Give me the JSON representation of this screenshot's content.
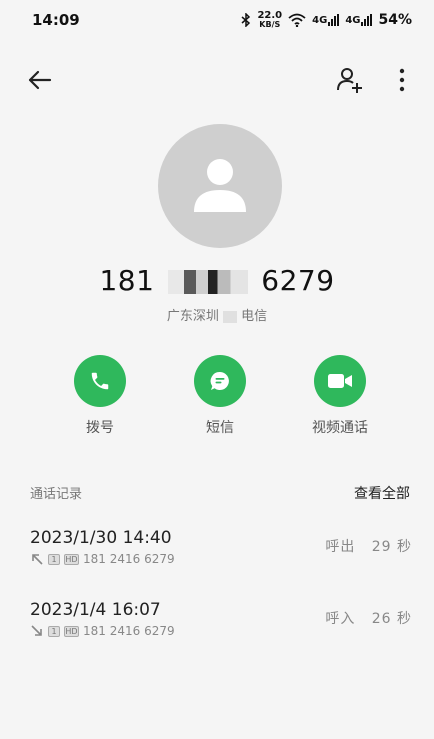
{
  "status_bar": {
    "time": "14:09",
    "net_speed_value": "22.0",
    "net_speed_unit": "KB/S",
    "signal_label_1": "4G",
    "signal_label_2": "4G",
    "battery": "54%"
  },
  "contact": {
    "number_prefix": "181",
    "number_suffix": "6279",
    "location_prefix": "广东深圳",
    "location_suffix": "电信"
  },
  "actions": {
    "call_label": "拨号",
    "sms_label": "短信",
    "video_label": "视频通话"
  },
  "call_log": {
    "title": "通话记录",
    "view_all": "查看全部",
    "records": [
      {
        "datetime": "2023/1/30  14:40",
        "sim": "1",
        "hd": "HD",
        "number": "181  2416  6279",
        "direction": "呼出",
        "duration": "29  秒"
      },
      {
        "datetime": "2023/1/4  16:07",
        "sim": "1",
        "hd": "HD",
        "number": "181  2416  6279",
        "direction": "呼入",
        "duration": "26  秒"
      }
    ]
  },
  "colors": {
    "accent_green": "#2fb85c",
    "avatar_bg": "#cfcfcf",
    "page_bg": "#f5f5f5"
  }
}
